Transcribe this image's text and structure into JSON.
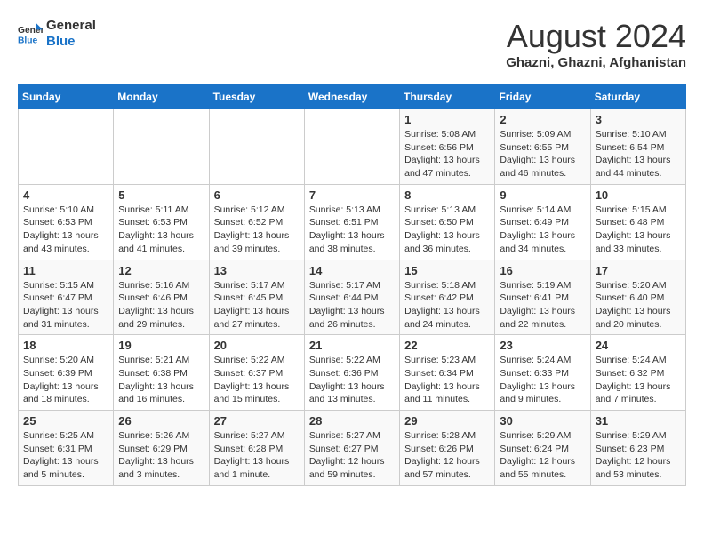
{
  "header": {
    "logo_line1": "General",
    "logo_line2": "Blue",
    "month": "August 2024",
    "location": "Ghazni, Ghazni, Afghanistan"
  },
  "weekdays": [
    "Sunday",
    "Monday",
    "Tuesday",
    "Wednesday",
    "Thursday",
    "Friday",
    "Saturday"
  ],
  "weeks": [
    [
      {
        "day": "",
        "content": ""
      },
      {
        "day": "",
        "content": ""
      },
      {
        "day": "",
        "content": ""
      },
      {
        "day": "",
        "content": ""
      },
      {
        "day": "1",
        "content": "Sunrise: 5:08 AM\nSunset: 6:56 PM\nDaylight: 13 hours\nand 47 minutes."
      },
      {
        "day": "2",
        "content": "Sunrise: 5:09 AM\nSunset: 6:55 PM\nDaylight: 13 hours\nand 46 minutes."
      },
      {
        "day": "3",
        "content": "Sunrise: 5:10 AM\nSunset: 6:54 PM\nDaylight: 13 hours\nand 44 minutes."
      }
    ],
    [
      {
        "day": "4",
        "content": "Sunrise: 5:10 AM\nSunset: 6:53 PM\nDaylight: 13 hours\nand 43 minutes."
      },
      {
        "day": "5",
        "content": "Sunrise: 5:11 AM\nSunset: 6:53 PM\nDaylight: 13 hours\nand 41 minutes."
      },
      {
        "day": "6",
        "content": "Sunrise: 5:12 AM\nSunset: 6:52 PM\nDaylight: 13 hours\nand 39 minutes."
      },
      {
        "day": "7",
        "content": "Sunrise: 5:13 AM\nSunset: 6:51 PM\nDaylight: 13 hours\nand 38 minutes."
      },
      {
        "day": "8",
        "content": "Sunrise: 5:13 AM\nSunset: 6:50 PM\nDaylight: 13 hours\nand 36 minutes."
      },
      {
        "day": "9",
        "content": "Sunrise: 5:14 AM\nSunset: 6:49 PM\nDaylight: 13 hours\nand 34 minutes."
      },
      {
        "day": "10",
        "content": "Sunrise: 5:15 AM\nSunset: 6:48 PM\nDaylight: 13 hours\nand 33 minutes."
      }
    ],
    [
      {
        "day": "11",
        "content": "Sunrise: 5:15 AM\nSunset: 6:47 PM\nDaylight: 13 hours\nand 31 minutes."
      },
      {
        "day": "12",
        "content": "Sunrise: 5:16 AM\nSunset: 6:46 PM\nDaylight: 13 hours\nand 29 minutes."
      },
      {
        "day": "13",
        "content": "Sunrise: 5:17 AM\nSunset: 6:45 PM\nDaylight: 13 hours\nand 27 minutes."
      },
      {
        "day": "14",
        "content": "Sunrise: 5:17 AM\nSunset: 6:44 PM\nDaylight: 13 hours\nand 26 minutes."
      },
      {
        "day": "15",
        "content": "Sunrise: 5:18 AM\nSunset: 6:42 PM\nDaylight: 13 hours\nand 24 minutes."
      },
      {
        "day": "16",
        "content": "Sunrise: 5:19 AM\nSunset: 6:41 PM\nDaylight: 13 hours\nand 22 minutes."
      },
      {
        "day": "17",
        "content": "Sunrise: 5:20 AM\nSunset: 6:40 PM\nDaylight: 13 hours\nand 20 minutes."
      }
    ],
    [
      {
        "day": "18",
        "content": "Sunrise: 5:20 AM\nSunset: 6:39 PM\nDaylight: 13 hours\nand 18 minutes."
      },
      {
        "day": "19",
        "content": "Sunrise: 5:21 AM\nSunset: 6:38 PM\nDaylight: 13 hours\nand 16 minutes."
      },
      {
        "day": "20",
        "content": "Sunrise: 5:22 AM\nSunset: 6:37 PM\nDaylight: 13 hours\nand 15 minutes."
      },
      {
        "day": "21",
        "content": "Sunrise: 5:22 AM\nSunset: 6:36 PM\nDaylight: 13 hours\nand 13 minutes."
      },
      {
        "day": "22",
        "content": "Sunrise: 5:23 AM\nSunset: 6:34 PM\nDaylight: 13 hours\nand 11 minutes."
      },
      {
        "day": "23",
        "content": "Sunrise: 5:24 AM\nSunset: 6:33 PM\nDaylight: 13 hours\nand 9 minutes."
      },
      {
        "day": "24",
        "content": "Sunrise: 5:24 AM\nSunset: 6:32 PM\nDaylight: 13 hours\nand 7 minutes."
      }
    ],
    [
      {
        "day": "25",
        "content": "Sunrise: 5:25 AM\nSunset: 6:31 PM\nDaylight: 13 hours\nand 5 minutes."
      },
      {
        "day": "26",
        "content": "Sunrise: 5:26 AM\nSunset: 6:29 PM\nDaylight: 13 hours\nand 3 minutes."
      },
      {
        "day": "27",
        "content": "Sunrise: 5:27 AM\nSunset: 6:28 PM\nDaylight: 13 hours\nand 1 minute."
      },
      {
        "day": "28",
        "content": "Sunrise: 5:27 AM\nSunset: 6:27 PM\nDaylight: 12 hours\nand 59 minutes."
      },
      {
        "day": "29",
        "content": "Sunrise: 5:28 AM\nSunset: 6:26 PM\nDaylight: 12 hours\nand 57 minutes."
      },
      {
        "day": "30",
        "content": "Sunrise: 5:29 AM\nSunset: 6:24 PM\nDaylight: 12 hours\nand 55 minutes."
      },
      {
        "day": "31",
        "content": "Sunrise: 5:29 AM\nSunset: 6:23 PM\nDaylight: 12 hours\nand 53 minutes."
      }
    ]
  ]
}
